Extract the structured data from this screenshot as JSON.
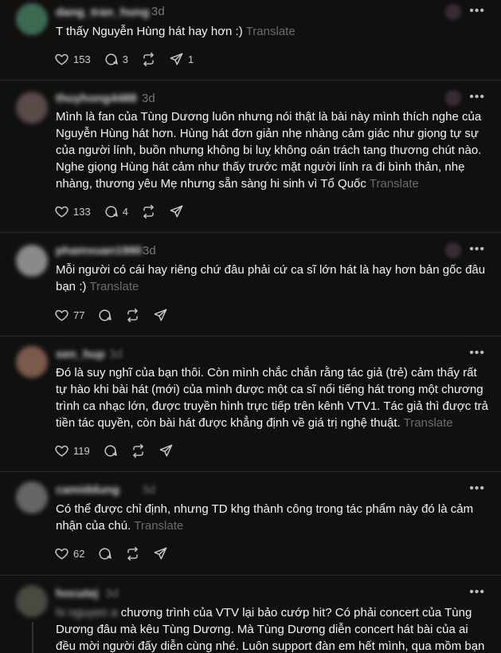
{
  "translate_label": "Translate",
  "posts": [
    {
      "username": "dang_tran_hung",
      "time": "3d",
      "text": "T thấy Nguyễn Hùng hát hay hơn :)",
      "likes": "153",
      "replies": "3",
      "reposts": "",
      "shares": "1"
    },
    {
      "username": "thuyhong4488",
      "time": "3d",
      "text": "Mình là fan của Tùng Dương luôn nhưng nói thật là bài này mình thích nghe của Nguyễn Hùng hát hơn. Hùng hát đơn giản nhẹ nhàng cảm giác như giọng tự sự của người lính, buồn nhưng không bi luỵ không oán trách tang thương chút nào. Nghe giọng Hùng hát cảm như thấy trước mặt người lính ra đi bình thản, nhẹ nhàng, thương yêu Mẹ nhưng sẵn sàng hi sinh vì Tổ Quốc",
      "likes": "133",
      "replies": "4",
      "reposts": "",
      "shares": ""
    },
    {
      "username": "phamxuan1990",
      "time": "3d",
      "text": "Mỗi người có cái hay riêng chứ đâu phải cứ ca sĩ lớn hát là hay hơn bản gốc đâu bạn :)",
      "likes": "77",
      "replies": "",
      "reposts": "",
      "shares": ""
    },
    {
      "username": "sen_hup",
      "time": "3d",
      "text": "Đó là suy nghĩ của bạn thôi. Còn mình chắc chắn rằng tác giả (trẻ) cảm thấy rất tự hào khi bài hát (mới) của mình được một ca sĩ nổi tiếng hát trong một chương trình ca nhạc lớn, được truyền hình trực tiếp trên kênh VTV1. Tác giả thì được trả tiền tác quyền, còn bài hát được khẳng định về giá trị nghệ thuật.",
      "likes": "119",
      "replies": "",
      "reposts": "",
      "shares": ""
    },
    {
      "username": "camiddung",
      "time": "3d",
      "text": "Có thể được chỉ định, nhưng TD khg thành công trong tác phẩm này đó là cảm nhận của chú.",
      "likes": "62",
      "replies": "",
      "reposts": "",
      "shares": ""
    },
    {
      "username": "hocutej",
      "time": "3d",
      "mention": "hi nguyen a",
      "text": "chương trình của VTV lại bảo cướp hit? Có phải concert của Tùng Dương đâu mà kêu Tùng Dương. Mà Tùng Dương diễn concert hát bài của ai đều mời người đấy diễn cùng nhé. Luôn support đàn em hết mình, qua mồm bạn",
      "likes": "",
      "replies": "",
      "reposts": "",
      "shares": ""
    }
  ]
}
